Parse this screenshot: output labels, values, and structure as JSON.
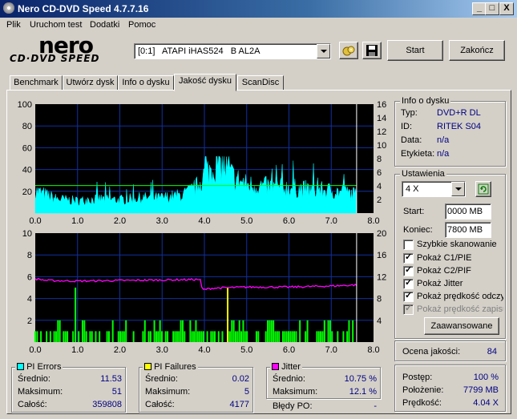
{
  "app": {
    "title": "Nero CD-DVD Speed 4.7.7.16",
    "logo_top": "nero",
    "logo_bottom": "CD·DVD SPEED"
  },
  "window_buttons": {
    "min": "_",
    "max": "□",
    "close": "X"
  },
  "menu": [
    "Plik",
    "Uruchom test",
    "Dodatki",
    "Pomoc"
  ],
  "drive": {
    "value": "[0:1]   ATAPI iHAS524   B AL2A"
  },
  "buttons": {
    "start": "Start",
    "end": "Zakończ",
    "advanced": "Zaawansowane"
  },
  "tabs": [
    "Benchmark",
    "Utwórz dysk",
    "Info o dysku",
    "Jakość dysku",
    "ScanDisc"
  ],
  "active_tab": 3,
  "disc_info": {
    "title": "Info o dysku",
    "rows": [
      {
        "label": "Typ:",
        "value": "DVD+R DL"
      },
      {
        "label": "ID:",
        "value": "RITEK S04"
      },
      {
        "label": "Data:",
        "value": "n/a"
      },
      {
        "label": "Etykieta:",
        "value": "n/a"
      }
    ]
  },
  "settings": {
    "title": "Ustawienia",
    "speed": "4 X",
    "start_label": "Start:",
    "start_value": "0000 MB",
    "end_label": "Koniec:",
    "end_value": "7800 MB",
    "checkboxes": [
      {
        "label": "Szybkie skanowanie",
        "checked": false,
        "disabled": false
      },
      {
        "label": "Pokaż C1/PIE",
        "checked": true,
        "disabled": false
      },
      {
        "label": "Pokaż C2/PIF",
        "checked": true,
        "disabled": false
      },
      {
        "label": "Pokaż Jitter",
        "checked": true,
        "disabled": false
      },
      {
        "label": "Pokaż prędkość odczytu",
        "checked": true,
        "disabled": false
      },
      {
        "label": "Pokaż prędkość zapisu",
        "checked": true,
        "disabled": true
      }
    ]
  },
  "quality": {
    "label": "Ocena jakości:",
    "value": "84"
  },
  "progress": {
    "rows": [
      {
        "label": "Postęp:",
        "value": "100 %"
      },
      {
        "label": "Położenie:",
        "value": "7799 MB"
      },
      {
        "label": "Prędkość:",
        "value": "4.04 X"
      }
    ]
  },
  "pi_errors": {
    "title": "PI Errors",
    "color": "#00ffff",
    "rows": [
      {
        "label": "Średnio:",
        "value": "11.53"
      },
      {
        "label": "Maksimum:",
        "value": "51"
      },
      {
        "label": "Całość:",
        "value": "359808"
      }
    ]
  },
  "pi_failures": {
    "title": "PI Failures",
    "color": "#ffff00",
    "rows": [
      {
        "label": "Średnio:",
        "value": "0.02"
      },
      {
        "label": "Maksimum:",
        "value": "5"
      },
      {
        "label": "Całość:",
        "value": "4177"
      }
    ]
  },
  "jitter": {
    "title": "Jitter",
    "color": "#ff00ff",
    "rows": [
      {
        "label": "Średnio:",
        "value": "10.75 %"
      },
      {
        "label": "Maksimum:",
        "value": "12.1 %"
      }
    ],
    "po_label": "Błędy PO:",
    "po_value": "-"
  },
  "chart_data": [
    {
      "type": "area",
      "series": [
        {
          "name": "PI Errors",
          "color": "#00ffff"
        },
        {
          "name": "Read speed",
          "color": "#00ff00"
        }
      ],
      "x_ticks": [
        "0.0",
        "1.0",
        "2.0",
        "3.0",
        "4.0",
        "5.0",
        "6.0",
        "7.0",
        "8.0"
      ],
      "y_left_ticks": [
        "100",
        "80",
        "60",
        "40",
        "20"
      ],
      "y_right_ticks": [
        "16",
        "14",
        "12",
        "10",
        "8",
        "6",
        "4",
        "2"
      ],
      "xlim": [
        0,
        8
      ],
      "ylim": [
        0,
        100
      ],
      "y2lim": [
        0,
        16
      ],
      "end_x": 7.6,
      "pi_profile": [
        [
          0,
          22
        ],
        [
          0.5,
          14
        ],
        [
          1,
          12
        ],
        [
          1.5,
          14
        ],
        [
          2,
          13
        ],
        [
          2.5,
          15
        ],
        [
          3,
          15
        ],
        [
          3.5,
          18
        ],
        [
          3.8,
          25
        ],
        [
          4.0,
          38
        ],
        [
          4.2,
          46
        ],
        [
          4.35,
          50
        ],
        [
          4.5,
          44
        ],
        [
          4.7,
          35
        ],
        [
          5.0,
          28
        ],
        [
          5.5,
          26
        ],
        [
          6.0,
          25
        ],
        [
          6.5,
          23
        ],
        [
          7.0,
          22
        ],
        [
          7.5,
          19
        ],
        [
          7.6,
          18
        ]
      ],
      "speed": 4.04
    },
    {
      "type": "bar",
      "series": [
        {
          "name": "PI Failures",
          "color": "#00ff00"
        },
        {
          "name": "Jitter",
          "color": "#ff00ff"
        }
      ],
      "x_ticks": [
        "0.0",
        "1.0",
        "2.0",
        "3.0",
        "4.0",
        "5.0",
        "6.0",
        "7.0",
        "8.0"
      ],
      "y_left_ticks": [
        "10",
        "8",
        "6",
        "4",
        "2"
      ],
      "y_right_ticks": [
        "20",
        "16",
        "12",
        "8",
        "4"
      ],
      "xlim": [
        0,
        8
      ],
      "ylim": [
        0,
        10
      ],
      "end_x": 7.6,
      "jitter_profile": [
        [
          0,
          11.6
        ],
        [
          0.3,
          11.3
        ],
        [
          1.0,
          11.2
        ],
        [
          2.0,
          11.3
        ],
        [
          3.0,
          11.4
        ],
        [
          3.9,
          11.5
        ],
        [
          3.95,
          9.6
        ],
        [
          4.2,
          9.9
        ],
        [
          5.0,
          10.1
        ],
        [
          6.0,
          10.1
        ],
        [
          7.0,
          10.3
        ],
        [
          7.6,
          10.5
        ]
      ],
      "pif_spikes": [
        [
          0.95,
          5
        ],
        [
          4.55,
          5
        ]
      ],
      "jitter_scale_max": 20
    }
  ]
}
